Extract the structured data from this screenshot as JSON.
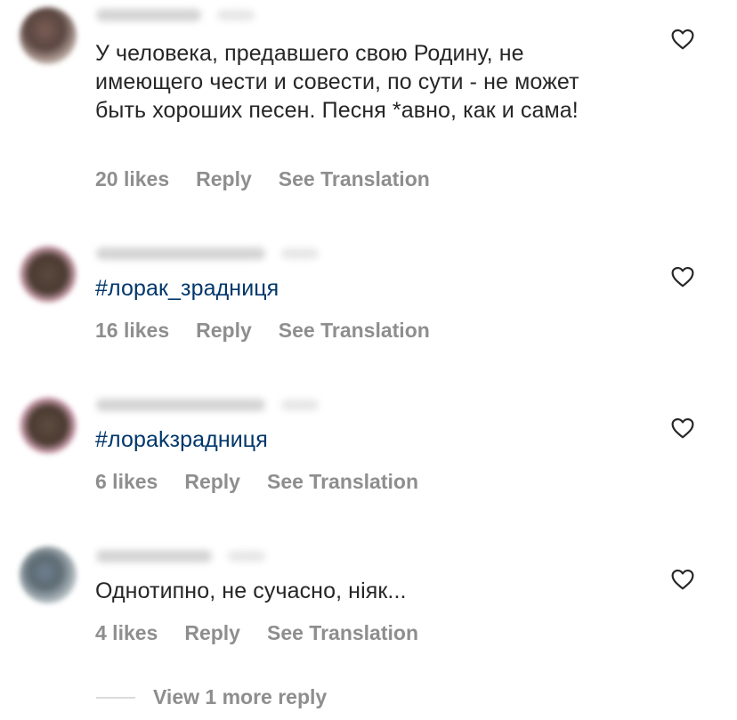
{
  "comments": [
    {
      "text": "У человека, предавшего свою Родину, не имеющего чести и совести, по сути - не может быть хороших песен. Песня *авно, как и сама!",
      "likes": "20 likes",
      "reply": "Reply",
      "translate": "See Translation"
    },
    {
      "text": "#лорак_зрадниця",
      "likes": "16 likes",
      "reply": "Reply",
      "translate": "See Translation"
    },
    {
      "text": "#лораkзрадниця",
      "likes": "6 likes",
      "reply": "Reply",
      "translate": "See Translation"
    },
    {
      "text": "Однотипно, не сучасно, ніяк...",
      "likes": "4 likes",
      "reply": "Reply",
      "translate": "See Translation"
    }
  ],
  "view_more": "View 1 more reply",
  "icons": {
    "like": "heart-outline-icon"
  },
  "colors": {
    "text": "#262626",
    "meta": "#8e8e8e",
    "hashtag": "#00376b"
  }
}
